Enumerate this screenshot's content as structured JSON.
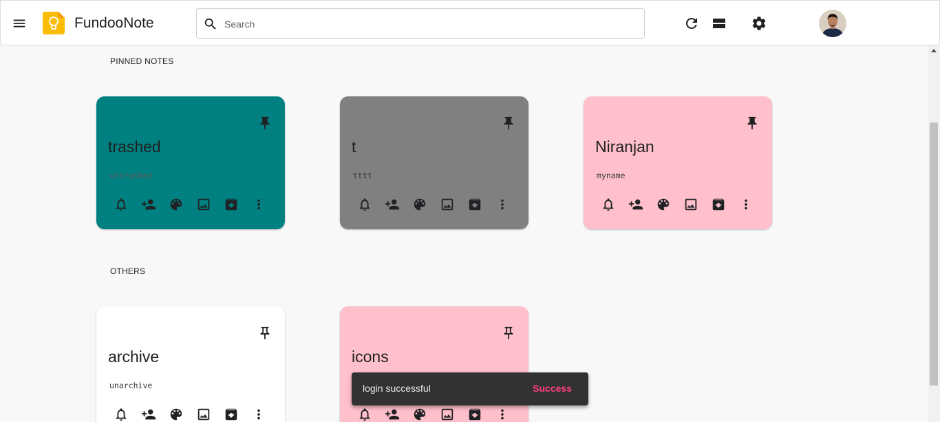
{
  "header": {
    "app_title": "FundooNote",
    "search_placeholder": "Search",
    "search_value": ""
  },
  "sections": {
    "pinned_title": "PINNED NOTES",
    "others_title": "OTHERS"
  },
  "notes": {
    "pinned": [
      {
        "title": "trashed",
        "body": "untrashed",
        "color": "#008080",
        "body_color": "#5e5e5e"
      },
      {
        "title": "t",
        "body": "tttt",
        "color": "#808080",
        "body_color": "#3c3c3c"
      },
      {
        "title": "Niranjan",
        "body": "myname",
        "color": "#ffc0cb",
        "body_color": "#3c3c3c"
      }
    ],
    "others": [
      {
        "title": "archive",
        "body": "unarchive",
        "color": "#ffffff",
        "body_color": "#3c3c3c"
      },
      {
        "title": "icons",
        "body": "",
        "color": "#ffc0cb",
        "body_color": "#3c3c3c"
      }
    ]
  },
  "note_actions": [
    "bell-icon",
    "add-person-icon",
    "palette-icon",
    "image-icon",
    "archive-icon",
    "more-vert-icon"
  ],
  "snackbar": {
    "message": "login successful",
    "action_label": "Success",
    "action_color": "#ff4081"
  },
  "colors": {
    "logo": "#fbbc04",
    "background": "#f8f8f8",
    "snackbar_bg": "#323232"
  }
}
